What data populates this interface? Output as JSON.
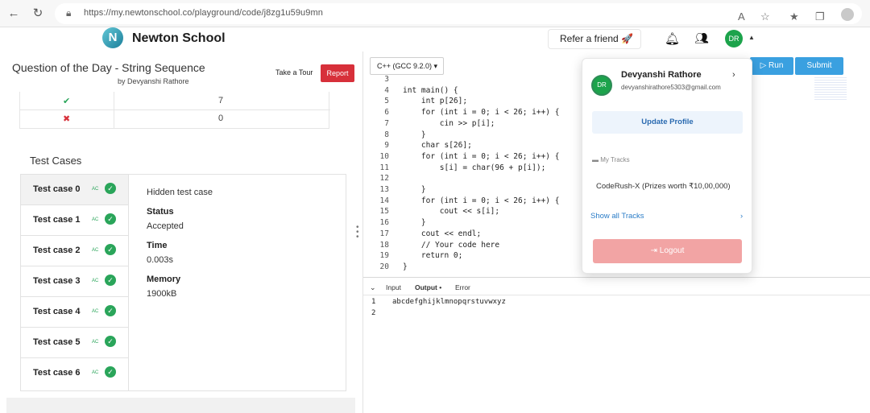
{
  "browser": {
    "url": "https://my.newtonschool.co/playground/code/j8zg1u59u9mn"
  },
  "header": {
    "logo_letter": "N",
    "brand": "Newton School",
    "refer": "Refer a friend 🚀",
    "avatar_initials": "DR"
  },
  "question": {
    "title": "Question of the Day - String Sequence",
    "author": "by Devyanshi Rathore",
    "take_tour": "Take a Tour",
    "report": "Report"
  },
  "results_table": [
    {
      "status": "pass",
      "count": "7"
    },
    {
      "status": "fail",
      "count": "0"
    }
  ],
  "test_cases": {
    "heading": "Test Cases",
    "badge": "AC",
    "items": [
      {
        "label": "Test case 0"
      },
      {
        "label": "Test case 1"
      },
      {
        "label": "Test case 2"
      },
      {
        "label": "Test case 3"
      },
      {
        "label": "Test case 4"
      },
      {
        "label": "Test case 5"
      },
      {
        "label": "Test case 6"
      }
    ],
    "detail": {
      "type": "Hidden test case",
      "status_label": "Status",
      "status_value": "Accepted",
      "time_label": "Time",
      "time_value": "0.003s",
      "memory_label": "Memory",
      "memory_value": "1900kB"
    }
  },
  "editor": {
    "language": "C++ (GCC 9.2.0) ▾",
    "run": "Run",
    "submit": "Submit",
    "lines": [
      {
        "n": "3",
        "t": ""
      },
      {
        "n": "4",
        "t": "int main() {"
      },
      {
        "n": "5",
        "t": "    int p[26];"
      },
      {
        "n": "6",
        "t": "    for (int i = 0; i < 26; i++) {"
      },
      {
        "n": "7",
        "t": "        cin >> p[i];"
      },
      {
        "n": "8",
        "t": "    }"
      },
      {
        "n": "9",
        "t": "    char s[26];"
      },
      {
        "n": "10",
        "t": "    for (int i = 0; i < 26; i++) {"
      },
      {
        "n": "11",
        "t": "        s[i] = char(96 + p[i]);"
      },
      {
        "n": "12",
        "t": ""
      },
      {
        "n": "13",
        "t": "    }"
      },
      {
        "n": "14",
        "t": "    for (int i = 0; i < 26; i++) {"
      },
      {
        "n": "15",
        "t": "        cout << s[i];"
      },
      {
        "n": "16",
        "t": "    }"
      },
      {
        "n": "17",
        "t": "    cout << endl;"
      },
      {
        "n": "18",
        "t": "    // Your code here"
      },
      {
        "n": "19",
        "t": "    return 0;"
      },
      {
        "n": "20",
        "t": "}"
      }
    ],
    "tabs": [
      "Input",
      "Output •",
      "Error"
    ],
    "output_lines": [
      {
        "n": "1",
        "t": "abcdefghijklmnopqrstuvwxyz"
      },
      {
        "n": "2",
        "t": ""
      }
    ]
  },
  "profile_menu": {
    "initials": "DR",
    "name": "Devyanshi Rathore",
    "email": "devyanshirathore5303@gmail.com",
    "update_profile": "Update Profile",
    "my_tracks": "My Tracks",
    "track": "CodeRush-X (Prizes worth ₹10,00,000)",
    "show_all": "Show all Tracks",
    "logout": "Logout"
  },
  "colors": {
    "accent": "#3aa0e0",
    "report": "#d7303a",
    "success": "#2aa55a",
    "logout": "#f2a4a4"
  }
}
